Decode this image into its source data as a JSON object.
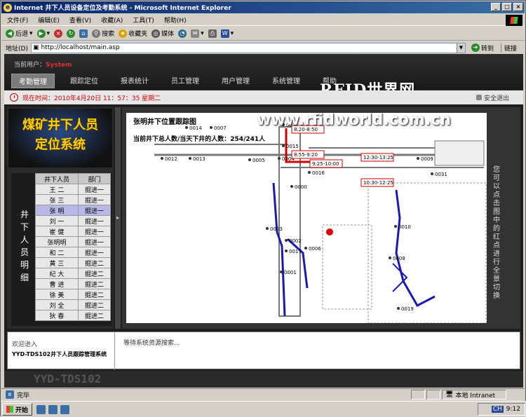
{
  "window": {
    "title": "Internet 井下人员设备定位及考勤系统 - Microsoft Internet Explorer",
    "buttons": [
      "_",
      "□",
      "×"
    ]
  },
  "menu": [
    "文件(F)",
    "编辑(E)",
    "查看(V)",
    "收藏(A)",
    "工具(T)",
    "帮助(H)"
  ],
  "toolbar": {
    "back": "后退",
    "search": "搜索",
    "favorites": "收藏夹",
    "media": "媒体"
  },
  "address": {
    "label": "地址(D)",
    "url": "http://localhost/main.asp",
    "go": "转到",
    "links": "链接"
  },
  "app": {
    "current_user_label": "当前用户：",
    "current_user": "System",
    "nav": [
      "考勤管理",
      "跟踪定位",
      "报表统计",
      "员工管理",
      "用户管理",
      "系统管理",
      "帮助"
    ],
    "active_nav": 0,
    "time_text": "现在时间：2010年4月20日 11：57：35 星期二",
    "logout": "安全退出",
    "watermark_top": "RFID世界网",
    "watermark_url": "www.rfidworld.com.cn",
    "logo_line1": "煤矿井下人员",
    "logo_line2": "定位系统",
    "staff_panel_label": "井下人员明细",
    "staff_columns": [
      "井下人员",
      "部门"
    ],
    "staff": [
      {
        "name": "王 二",
        "dept": "掘进一"
      },
      {
        "name": "张 三",
        "dept": "掘进一"
      },
      {
        "name": "张 明",
        "dept": "掘进一"
      },
      {
        "name": "刘 一",
        "dept": "掘进一"
      },
      {
        "name": "崔 健",
        "dept": "掘进一"
      },
      {
        "name": "张明明",
        "dept": "掘进一"
      },
      {
        "name": "和 二",
        "dept": "掘进一"
      },
      {
        "name": "黄 三",
        "dept": "掘进二"
      },
      {
        "name": "纪 大",
        "dept": "掘进二"
      },
      {
        "name": "曹 进",
        "dept": "掘进二"
      },
      {
        "name": "徐 美",
        "dept": "掘进二"
      },
      {
        "name": "刘 全",
        "dept": "掘进二"
      },
      {
        "name": "狄 春",
        "dept": "掘进二"
      }
    ],
    "selected_staff": 2,
    "map_title": "张明井下位置跟踪图",
    "count_text": "当前井下总人数/当天下井的人数：254/241人",
    "map_hint": "您可以点击图中的红点进行全景切换",
    "map_nodes": [
      {
        "id": "0014"
      },
      {
        "id": "0007"
      },
      {
        "id": "0011"
      },
      {
        "id": "0012"
      },
      {
        "id": "0013"
      },
      {
        "id": "0005"
      },
      {
        "id": "0004"
      },
      {
        "id": "0015"
      },
      {
        "id": "0016"
      },
      {
        "id": "0009"
      },
      {
        "id": "0003"
      },
      {
        "id": "0001"
      },
      {
        "id": "0002"
      },
      {
        "id": "0017"
      },
      {
        "id": "0006"
      },
      {
        "id": "0010"
      },
      {
        "id": "0019"
      },
      {
        "id": "0000"
      },
      {
        "id": "0031"
      },
      {
        "id": "0008"
      }
    ],
    "map_times": [
      "8:20-8:50",
      "8:55-9:20",
      "9:25-10:00",
      "12:30-13:25",
      "10:30-12:25"
    ],
    "welcome": "欢迎进入",
    "system_name": "YYD-TDS102井下人员跟踪管理系统",
    "loading": "等待系统资源搜索...",
    "footer_ver": "YYD-TDS102"
  },
  "ie_status": {
    "text": "完毕",
    "zone": "本地 Intranet"
  },
  "taskbar": {
    "start": "开始",
    "ime": "CH",
    "clock": "9:12"
  },
  "colors": {
    "title_bar": "#0a246a",
    "accent_red": "#e03030",
    "route_blue": "#1a1ab0",
    "route_red": "#d00000"
  }
}
